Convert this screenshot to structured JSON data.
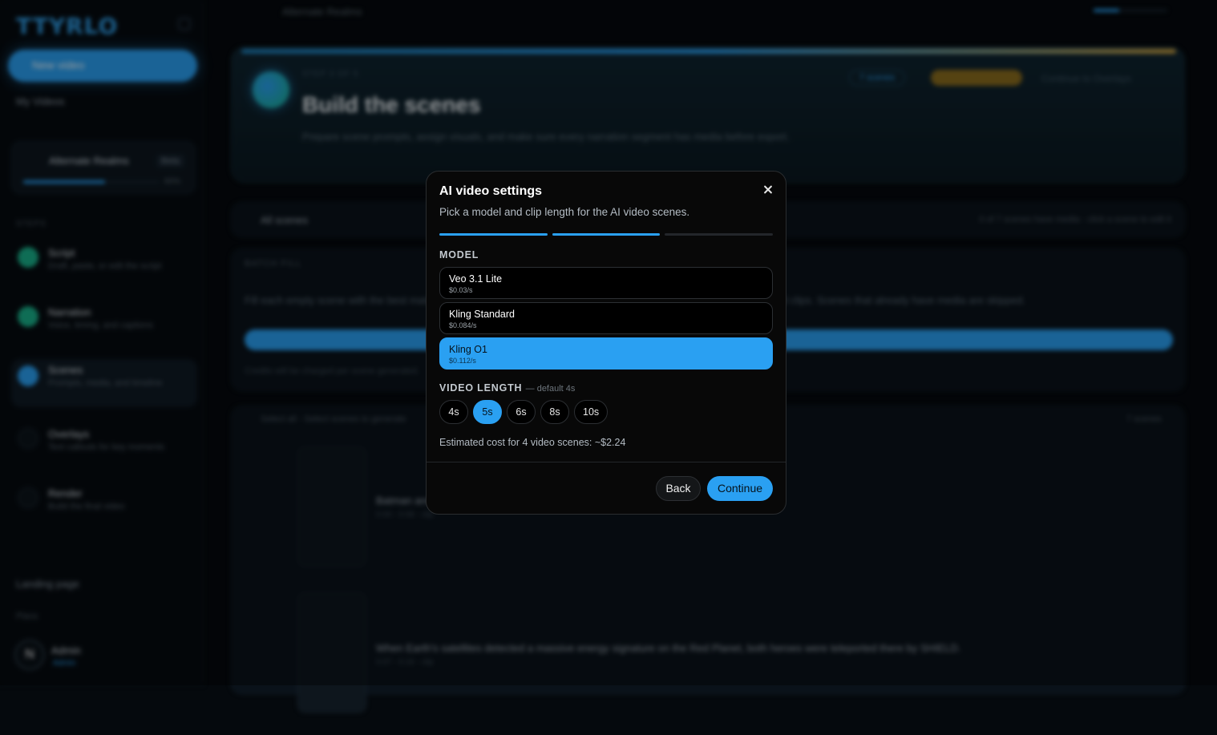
{
  "background": {
    "logo": "TTYRLO",
    "new_video_label": "New video",
    "my_videos_label": "My Videos",
    "project": {
      "name": "Alternate Realms",
      "badge": "Beta",
      "progress_percent": 60,
      "progress_label": "60%"
    },
    "section_label": "STEPS",
    "steps": [
      {
        "title": "Script",
        "subtitle": "Draft, paste, or edit the script"
      },
      {
        "title": "Narration",
        "subtitle": "Voice, timing, and captions"
      },
      {
        "title": "Scenes",
        "subtitle": "Prompts, media, and timeline"
      },
      {
        "title": "Overlays",
        "subtitle": "Text callouts for key moments"
      },
      {
        "title": "Render",
        "subtitle": "Build the final video"
      }
    ],
    "landing_page_label": "Landing page",
    "plans_label": "Plans",
    "user": {
      "initial": "N",
      "name": "Admin",
      "role": "Admin"
    },
    "topbar_project": "Alternate Realms",
    "hero": {
      "step_label": "STEP 3 OF 5",
      "title": "Build the scenes",
      "description": "Prepare scene prompts, assign visuals, and make sure every narration segment has media before export.",
      "badge": "7 scenes",
      "continue_label": "Continue to Overlays"
    },
    "all_scenes_label": "All scenes",
    "all_scenes_status": "0 of 7 scenes have media - click a scene to edit it",
    "batch_label": "BATCH FILL",
    "batch_text": "Fill each empty scene with the best match: AI video, stock video, or stock image. AI videos are generated as 4 second clips. Scenes that already have media are skipped.",
    "credits_note": "Credits will be charged per scene generated.",
    "select_all_label": "Select all - Select scenes to generate",
    "scene_count_label": "7 scenes",
    "scenes": [
      {
        "text": "Batman and the Justice League discover how it went down.",
        "meta": "0:00 - 0:08 - clip"
      },
      {
        "text": "When Earth's satellites detected a massive energy signature on the Red Planet, both heroes were teleported there by SHIELD.",
        "meta": "0:07 - 0:16 - clip"
      }
    ]
  },
  "modal": {
    "title": "AI video settings",
    "subtitle": "Pick a model and clip length for the AI video scenes.",
    "progress_steps": [
      true,
      true,
      false
    ],
    "model_label": "MODEL",
    "models": [
      {
        "name": "Veo 3.1 Lite",
        "price": "$0.03/s",
        "selected": false
      },
      {
        "name": "Kling Standard",
        "price": "$0.084/s",
        "selected": false
      },
      {
        "name": "Kling O1",
        "price": "$0.112/s",
        "selected": true
      }
    ],
    "length_label": "VIDEO LENGTH",
    "length_note": "— default 4s",
    "lengths": [
      {
        "label": "4s",
        "selected": false
      },
      {
        "label": "5s",
        "selected": true
      },
      {
        "label": "6s",
        "selected": false
      },
      {
        "label": "8s",
        "selected": false
      },
      {
        "label": "10s",
        "selected": false
      }
    ],
    "estimate": "Estimated cost for 4 video scenes: ~$2.24",
    "back_label": "Back",
    "continue_label": "Continue"
  },
  "colors": {
    "accent": "#2aa0f2",
    "modal_bg": "#080808",
    "page_bg": "#05090d"
  }
}
